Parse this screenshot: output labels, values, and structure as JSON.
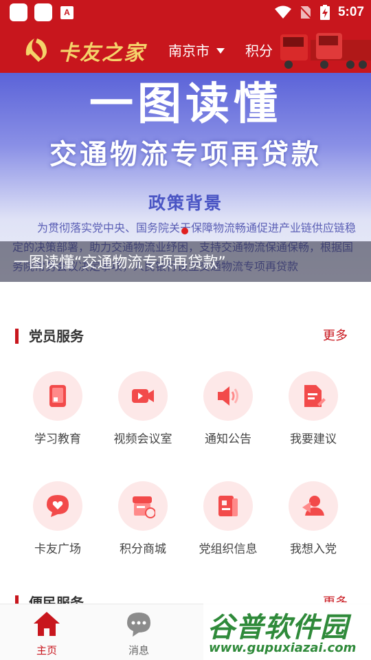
{
  "status_bar": {
    "time": "5:07"
  },
  "header": {
    "logo_text": "卡友之家",
    "city": "南京市",
    "points": "积分"
  },
  "banner": {
    "title": "一图读懂",
    "subtitle": "交通物流专项再贷款",
    "section": "政策背景",
    "body": "为贯彻落实党中央、国务院关于保障物流畅通促进产业链供应链稳定的决策部署，助力交通物流业纾困，支持交通物流保通保畅，根据国务院常务会议决定事项，人民银行设立交通物流专项再贷款",
    "caption": "一图读懂“交通物流专项再贷款”"
  },
  "party_services": {
    "title": "党员服务",
    "more": "更多",
    "items": [
      {
        "label": "学习教育",
        "icon": "study-icon"
      },
      {
        "label": "视频会议室",
        "icon": "video-icon"
      },
      {
        "label": "通知公告",
        "icon": "speaker-icon"
      },
      {
        "label": "我要建议",
        "icon": "suggest-icon"
      },
      {
        "label": "卡友广场",
        "icon": "heart-chat-icon"
      },
      {
        "label": "积分商城",
        "icon": "store-icon"
      },
      {
        "label": "党组织信息",
        "icon": "party-doc-icon"
      },
      {
        "label": "我想入党",
        "icon": "join-party-icon"
      }
    ]
  },
  "convenience": {
    "title": "便民服务",
    "more": "更多"
  },
  "nav": {
    "items": [
      {
        "label": "主页",
        "icon": "home-icon"
      },
      {
        "label": "消息",
        "icon": "message-icon"
      }
    ]
  },
  "watermark": {
    "text": "谷普软件园",
    "url": "www.gupuxiazai.com"
  },
  "colors": {
    "brand_red": "#c8161d",
    "icon_bg": "#fde8e8",
    "more_red": "#c8161d"
  }
}
